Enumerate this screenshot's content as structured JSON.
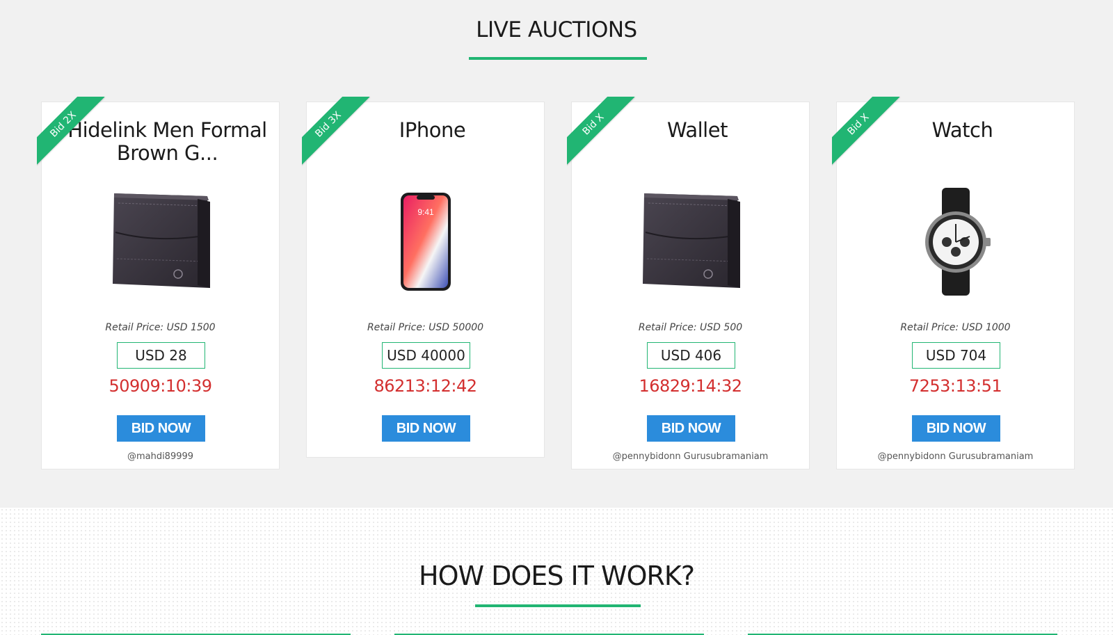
{
  "live_auctions": {
    "title": "LIVE AUCTIONS",
    "cards": [
      {
        "ribbon": "Bid 2X",
        "title": "Hidelink Men Formal Brown G...",
        "image": "wallet",
        "retail_price": "Retail Price: USD 1500",
        "current_bid": "USD 28",
        "countdown": "50909:10:39",
        "bid_button": "BID NOW",
        "seller": "@mahdi89999"
      },
      {
        "ribbon": "Bid 3X",
        "title": "IPhone",
        "image": "iphone",
        "retail_price": "Retail Price: USD 50000",
        "current_bid": "USD 40000",
        "countdown": "86213:12:42",
        "bid_button": "BID NOW",
        "seller": ""
      },
      {
        "ribbon": "Bid X",
        "title": "Wallet",
        "image": "wallet",
        "retail_price": "Retail Price: USD 500",
        "current_bid": "USD 406",
        "countdown": "16829:14:32",
        "bid_button": "BID NOW",
        "seller": "@pennybidonn Gurusubramaniam"
      },
      {
        "ribbon": "Bid X",
        "title": "Watch",
        "image": "watch",
        "retail_price": "Retail Price: USD 1000",
        "current_bid": "USD 704",
        "countdown": "7253:13:51",
        "bid_button": "BID NOW",
        "seller": "@pennybidonn Gurusubramaniam"
      }
    ]
  },
  "how_it_works": {
    "title": "HOW DOES IT WORK?"
  },
  "colors": {
    "accent": "#21b573",
    "button": "#2b8cdc",
    "countdown": "#d32f2f",
    "background": "#f1f1f1"
  }
}
